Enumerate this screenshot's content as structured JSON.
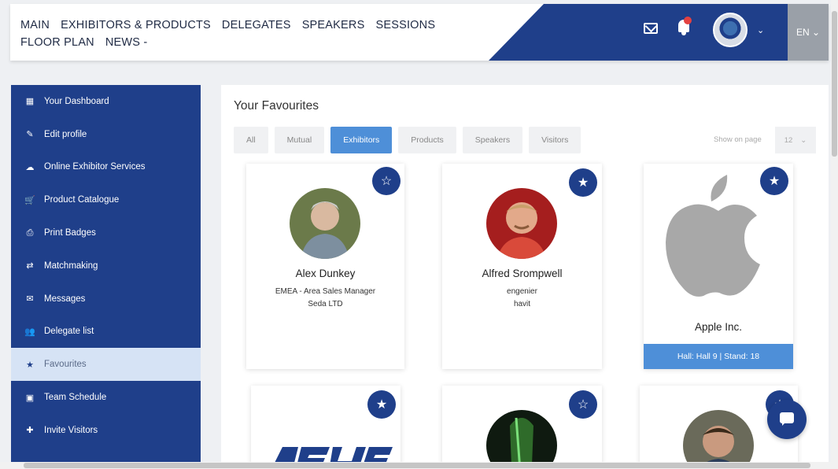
{
  "nav": {
    "items": [
      "MAIN",
      "EXHIBITORS & PRODUCTS",
      "DELEGATES",
      "SPEAKERS",
      "SESSIONS",
      "FLOOR PLAN",
      "NEWS -"
    ]
  },
  "header": {
    "icons": [
      "mail-icon",
      "bell-icon",
      "avatar",
      "chevron-down-icon"
    ],
    "lang": "EN ⌄"
  },
  "sidebar": {
    "items": [
      {
        "label": "Your Dashboard",
        "icon": "▦"
      },
      {
        "label": "Edit profile",
        "icon": "✎"
      },
      {
        "label": "Online Exhibitor Services",
        "icon": "☁"
      },
      {
        "label": "Product Catalogue",
        "icon": "🛒"
      },
      {
        "label": "Print Badges",
        "icon": "⎙"
      },
      {
        "label": "Matchmaking",
        "icon": "⇄"
      },
      {
        "label": "Messages",
        "icon": "✉"
      },
      {
        "label": "Delegate list",
        "icon": "👥"
      },
      {
        "label": "Favourites",
        "icon": "★"
      },
      {
        "label": "Team Schedule",
        "icon": "▣"
      },
      {
        "label": "Invite Visitors",
        "icon": "✚"
      }
    ],
    "active_index": 8
  },
  "main": {
    "title": "Your Favourites",
    "tabs": [
      "All",
      "Mutual",
      "Exhibitors",
      "Products",
      "Speakers",
      "Visitors"
    ],
    "active_tab": 2,
    "show_label": "Show on page",
    "page_size": "12",
    "cards": [
      {
        "name": "Alex Dunkey",
        "role": "EMEA - Area Sales Manager",
        "company": "Seda LTD"
      },
      {
        "name": "Alfred Srompwell",
        "role": "engenier",
        "company": "havit"
      },
      {
        "name": "Apple Inc.",
        "hall": "Hall: Hall 9 | Stand: 18"
      }
    ]
  },
  "colors": {
    "primary": "#1f3f8a",
    "accent": "#4e8fd8",
    "active_bg": "#d6e3f5"
  }
}
